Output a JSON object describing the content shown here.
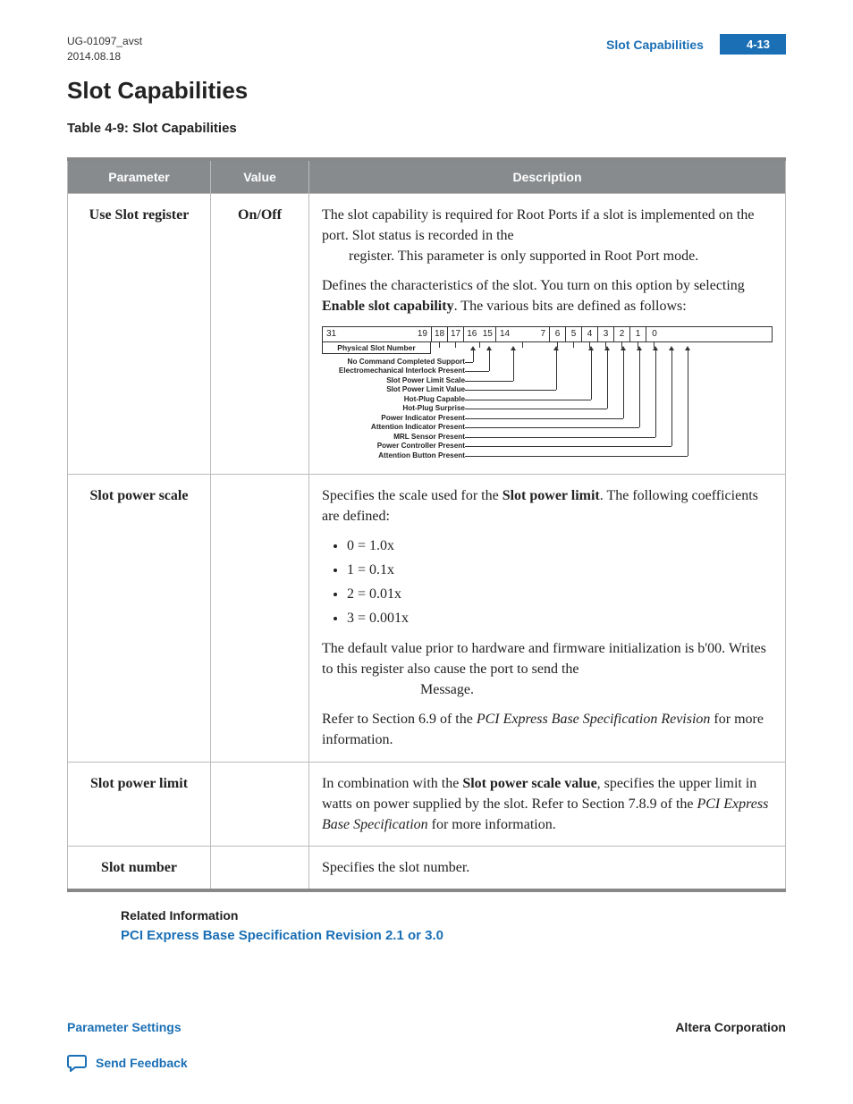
{
  "header": {
    "doc_id": "UG-01097_avst",
    "date": "2014.08.18",
    "title_right": "Slot Capabilities",
    "page_label": "4-13"
  },
  "section_title": "Slot Capabilities",
  "table_caption": "Table 4-9: Slot Capabilities",
  "columns": {
    "c0": "Parameter",
    "c1": "Value",
    "c2": "Description"
  },
  "rows": {
    "r0": {
      "param": "Use Slot register",
      "value": "On/Off",
      "desc_p1a": "The slot capability is required for Root Ports if a slot is implemented on the port. Slot status is recorded in the ",
      "desc_p1b": " register. This parameter is only supported in Root Port mode.",
      "desc_p2a": "Defines the characteristics of the slot. You turn on this option by selecting ",
      "desc_p2_bold": "Enable slot capability",
      "desc_p2b": ". The various bits are defined as follows:",
      "bits": {
        "b31": "31",
        "b19": "19",
        "b18": "18",
        "b17": "17",
        "b16": "16",
        "b15": "15",
        "b14": "14",
        "b7": "7",
        "b6": "6",
        "b5": "5",
        "b4": "4",
        "b3": "3",
        "b2": "2",
        "b1": "1",
        "b0": "0",
        "psn": "Physical Slot Number",
        "labels": [
          "No Command Completed Support",
          "Electromechanical Interlock Present",
          "Slot Power Limit Scale",
          "Slot Power Limit Value",
          "Hot-Plug Capable",
          "Hot-Plug Surprise",
          "Power Indicator Present",
          "Attention Indicator Present",
          "MRL Sensor Present",
          "Power Controller Present",
          "Attention Button Present"
        ]
      }
    },
    "r1": {
      "param": "Slot power scale",
      "value": "",
      "p1a": "Specifies the scale used for the ",
      "p1_bold": "Slot power limit",
      "p1b": ". The following coefficients are defined:",
      "li0": "0 = 1.0x",
      "li1": "1 = 0.1x",
      "li2": "2 = 0.01x",
      "li3": "3 = 0.001x",
      "p2": "The default value prior to hardware and firmware initialization is b'00. Writes to this register also cause the port to send the ",
      "p2b": " Message.",
      "p3a": "Refer to Section 6.9 of the ",
      "p3_ital": "PCI Express Base Specification Revision",
      "p3b": " for more information."
    },
    "r2": {
      "param": "Slot power limit",
      "value": "",
      "p1a": "In combination with the ",
      "p1_bold": "Slot power scale value",
      "p1b": ", specifies the upper limit in watts on power supplied by the slot. Refer to Section 7.8.9 of the ",
      "p1_ital": "PCI Express Base Specification",
      "p1c": " for more information."
    },
    "r3": {
      "param": "Slot number",
      "value": "",
      "p1": "Specifies the slot number."
    }
  },
  "related": {
    "heading": "Related Information",
    "link": "PCI Express Base Specification Revision 2.1 or 3.0"
  },
  "footer": {
    "left": "Parameter Settings",
    "right": "Altera Corporation",
    "feedback": "Send Feedback"
  }
}
